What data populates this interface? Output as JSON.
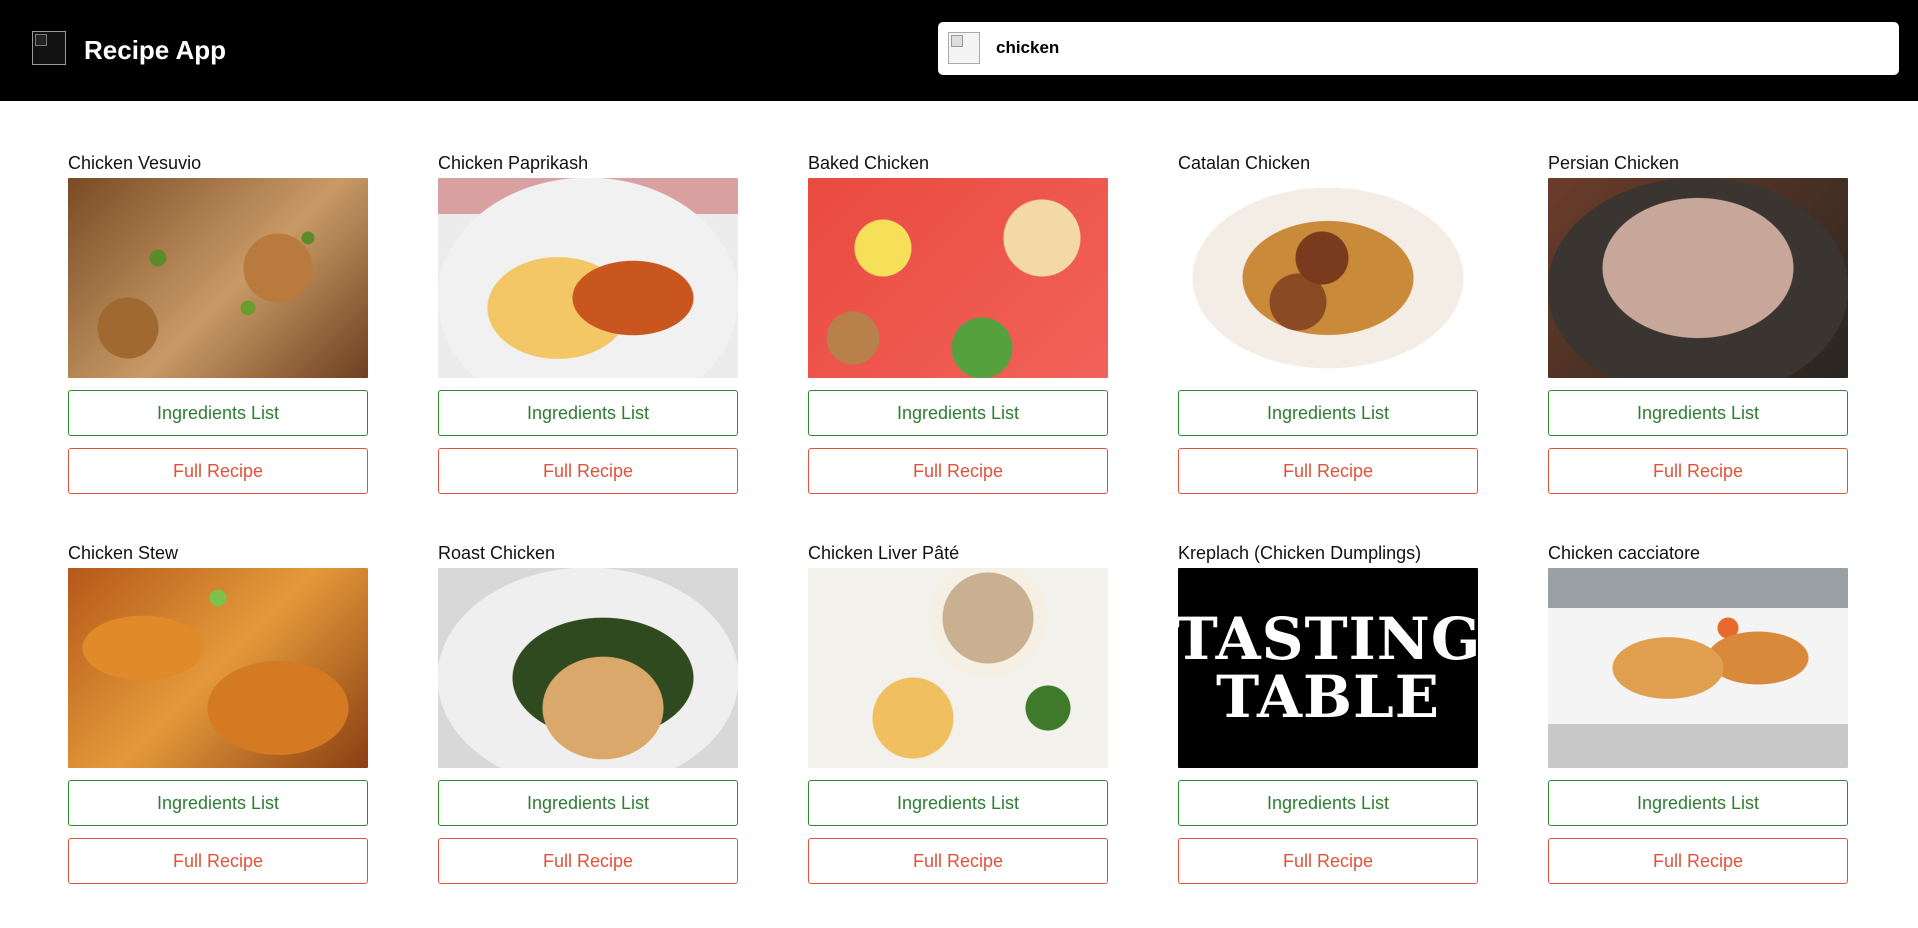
{
  "app": {
    "title": "Recipe App"
  },
  "search": {
    "value": "chicken"
  },
  "buttons": {
    "ingredients": "Ingredients List",
    "full_recipe": "Full Recipe"
  },
  "recipes": [
    {
      "title": "Chicken Vesuvio"
    },
    {
      "title": "Chicken Paprikash"
    },
    {
      "title": "Baked Chicken"
    },
    {
      "title": "Catalan Chicken"
    },
    {
      "title": "Persian Chicken"
    },
    {
      "title": "Chicken Stew"
    },
    {
      "title": "Roast Chicken"
    },
    {
      "title": "Chicken Liver Pâté"
    },
    {
      "title": "Kreplach (Chicken Dumplings)"
    },
    {
      "title": "Chicken cacciatore"
    }
  ],
  "tasting_table_logo": {
    "line1": "TASTING",
    "line2": "TABLE"
  }
}
